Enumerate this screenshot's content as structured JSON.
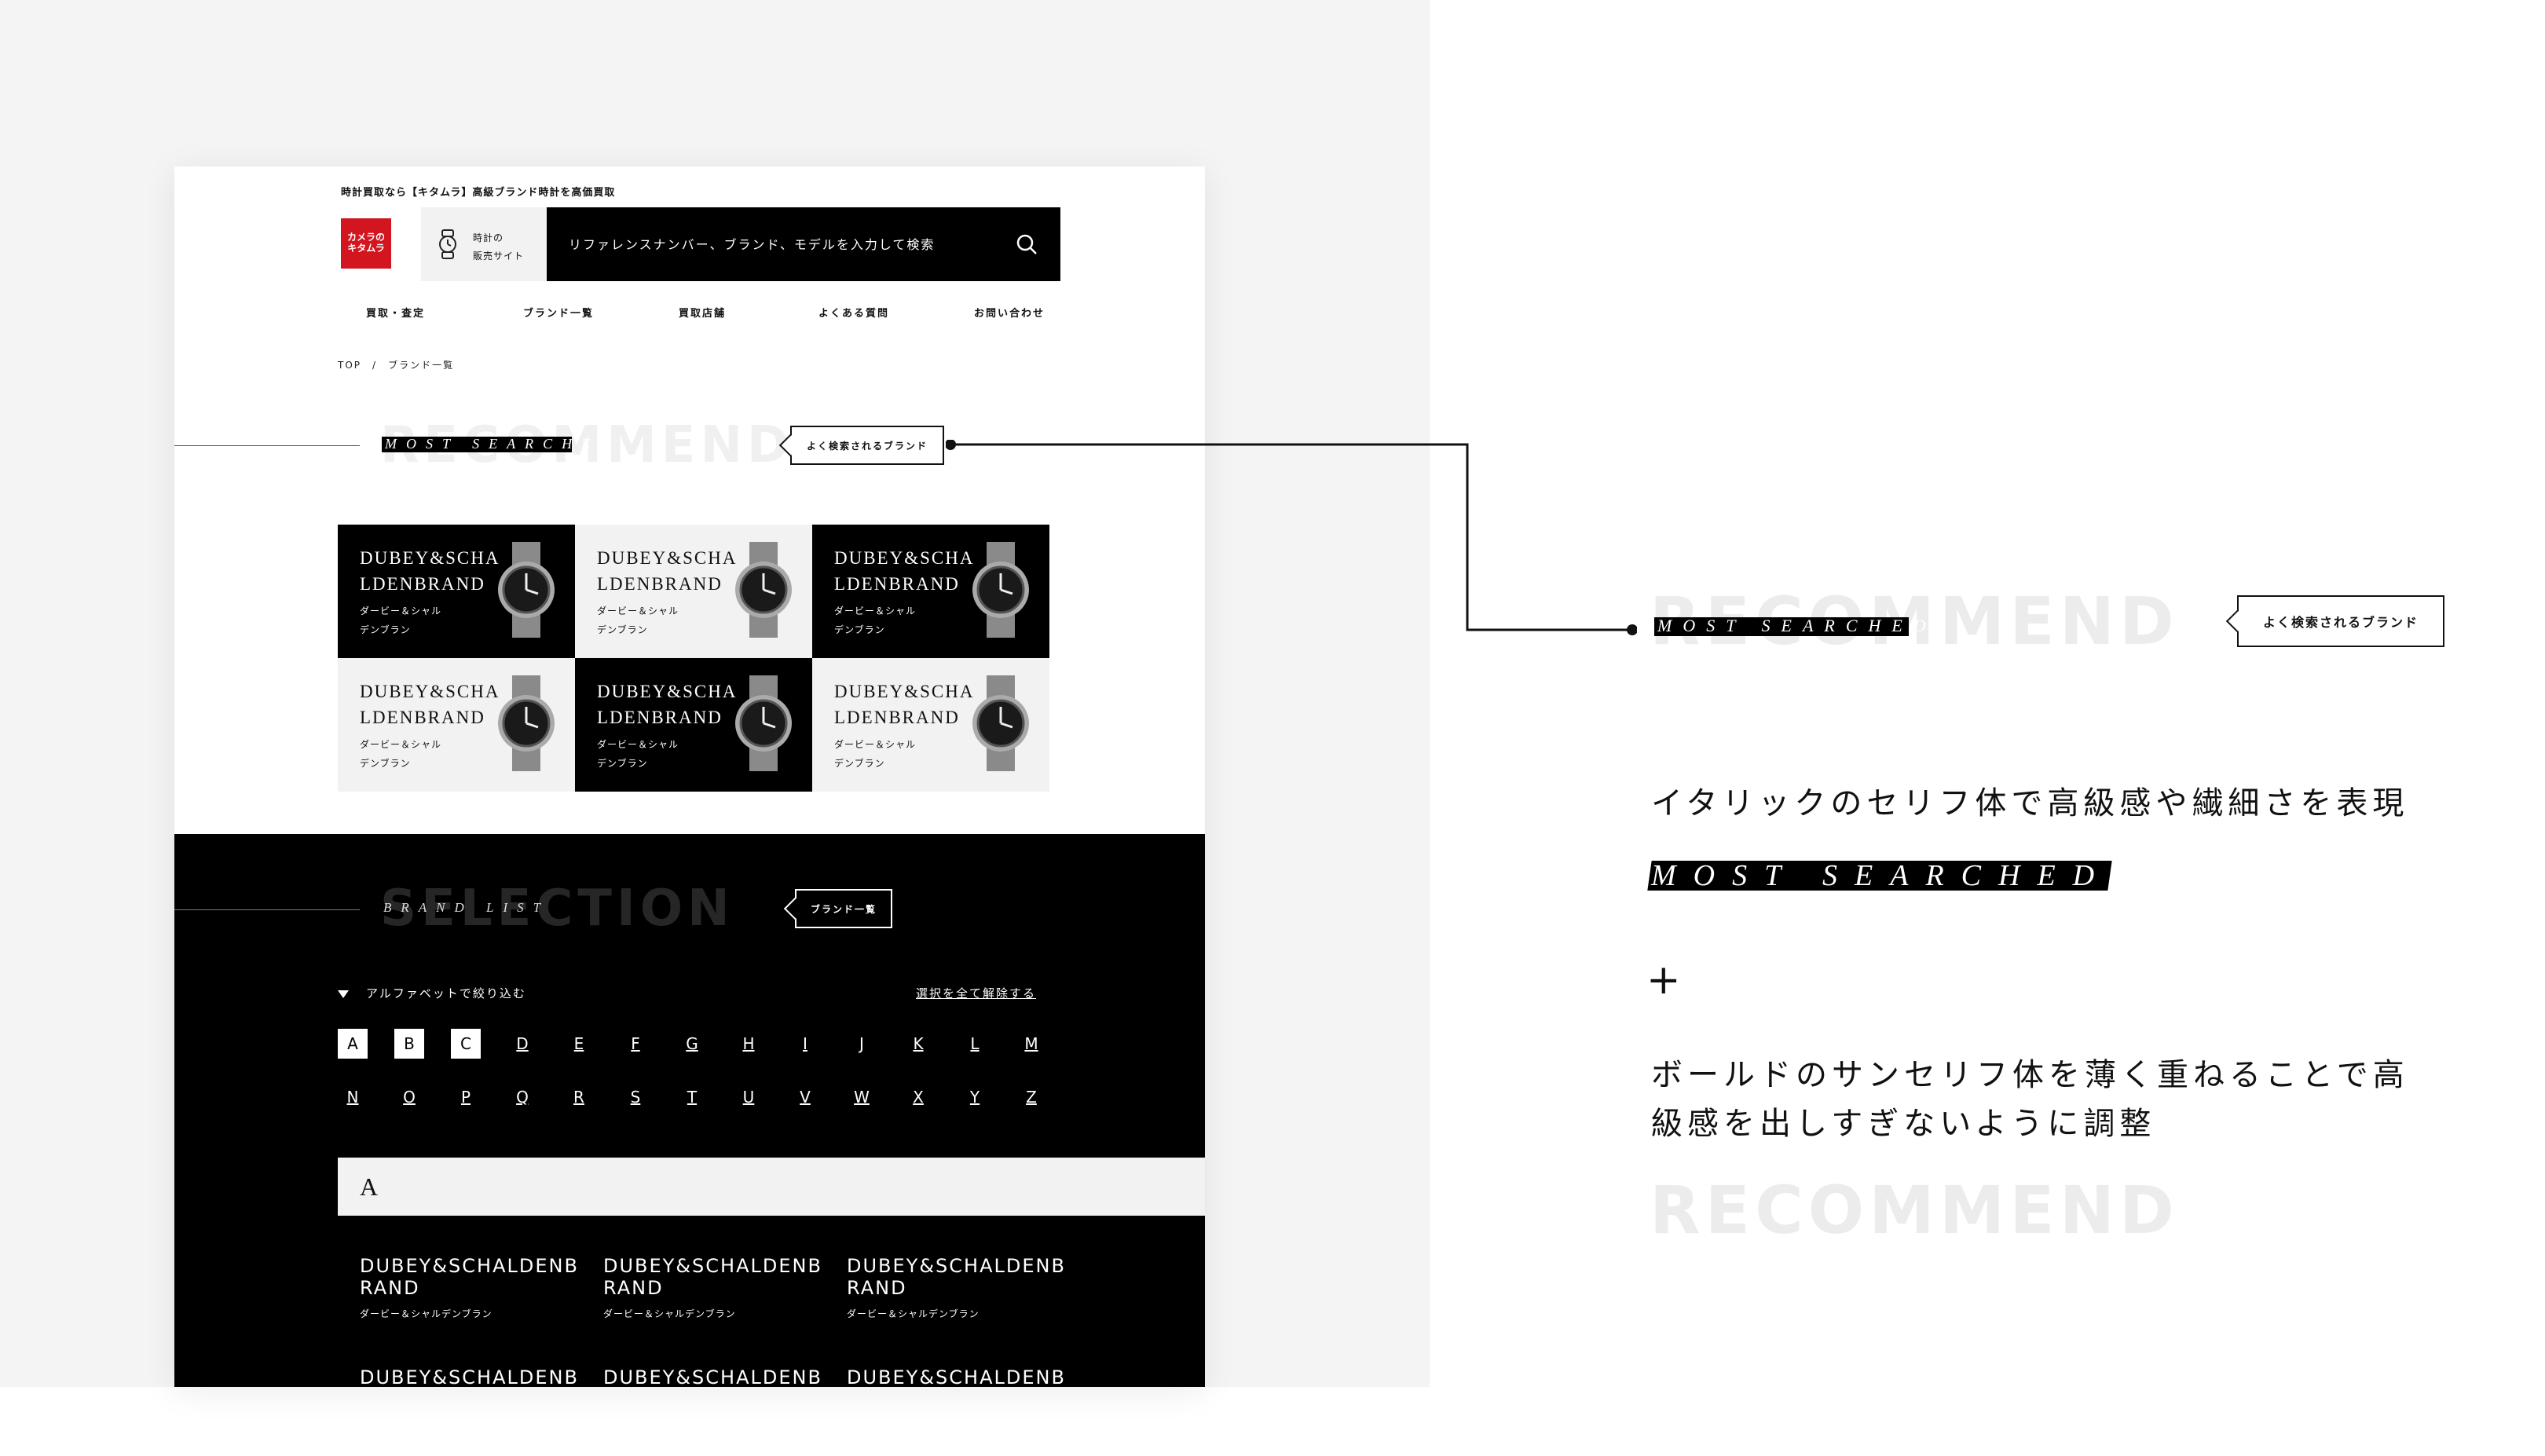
{
  "header": {
    "tagline": "時計買取なら【キタムラ】高級ブランド時計を高価買取",
    "logo_line1": "カメラの",
    "logo_line2": "キタムラ",
    "shop_link_line1": "時計の",
    "shop_link_line2": "販売サイト",
    "search_placeholder": "リファレンスナンバー、ブランド、モデルを入力して検索",
    "logo_color": "#d3151f"
  },
  "nav": [
    "買取・査定",
    "ブランド一覧",
    "買取店舗",
    "よくある質問",
    "お問い合わせ"
  ],
  "breadcrumb": {
    "home": "TOP",
    "sep": "/",
    "current": "ブランド一覧"
  },
  "recommend": {
    "ghost": "RECOMMEND",
    "label": "MOST SEARCHED",
    "bubble": "よく検索されるブランド"
  },
  "cards": [
    {
      "name": "DUBEY&SCHA LDENBRAND",
      "kana1": "ダービー＆シャル",
      "kana2": "デンブラン",
      "theme": "black"
    },
    {
      "name": "DUBEY&SCHA LDENBRAND",
      "kana1": "ダービー＆シャル",
      "kana2": "デンブラン",
      "theme": "light"
    },
    {
      "name": "DUBEY&SCHA LDENBRAND",
      "kana1": "ダービー＆シャル",
      "kana2": "デンブラン",
      "theme": "black"
    },
    {
      "name": "DUBEY&SCHA LDENBRAND",
      "kana1": "ダービー＆シャル",
      "kana2": "デンブラン",
      "theme": "light"
    },
    {
      "name": "DUBEY&SCHA LDENBRAND",
      "kana1": "ダービー＆シャル",
      "kana2": "デンブラン",
      "theme": "black"
    },
    {
      "name": "DUBEY&SCHA LDENBRAND",
      "kana1": "ダービー＆シャル",
      "kana2": "デンブラン",
      "theme": "light"
    }
  ],
  "selection": {
    "ghost": "SELECTION",
    "label": "BRAND LIST",
    "bubble": "ブランド一覧",
    "filter_label": "アルファベットで絞り込む",
    "clear_all": "選択を全て解除する",
    "letters_row1": [
      "A",
      "B",
      "C",
      "D",
      "E",
      "F",
      "G",
      "H",
      "I",
      "J",
      "K",
      "L",
      "M"
    ],
    "letters_row2": [
      "N",
      "O",
      "P",
      "Q",
      "R",
      "S",
      "T",
      "U",
      "V",
      "W",
      "X",
      "Y",
      "Z"
    ],
    "selected_letters": [
      "A",
      "B",
      "C"
    ],
    "current_letter": "A",
    "brands": [
      {
        "name": "DUBEY&SCHALDENBRAND",
        "kana": "ダービー＆シャルデンブラン"
      },
      {
        "name": "DUBEY&SCHALDENBRAND",
        "kana": "ダービー＆シャルデンブラン"
      },
      {
        "name": "DUBEY&SCHALDENBRAND",
        "kana": "ダービー＆シャルデンブラン"
      },
      {
        "name": "DUBEY&SCHALDENBR",
        "kana": ""
      },
      {
        "name": "DUBEY&SCHALDENBR",
        "kana": ""
      },
      {
        "name": "DUBEY&SCHALDENBR",
        "kana": ""
      }
    ]
  },
  "annotation": {
    "callout_ghost": "RECOMMEND",
    "callout_label": "MOST SEARCHED",
    "callout_bubble": "よく検索されるブランド",
    "text1": "イタリックのセリフ体で高級感や繊細さを表現",
    "sample_label": "MOST SEARCHED",
    "plus": "+",
    "text2_line1": "ボールドのサンセリフ体を薄く重ねることで高",
    "text2_line2": "級感を出しすぎないように調整",
    "sample_ghost": "RECOMMEND"
  }
}
